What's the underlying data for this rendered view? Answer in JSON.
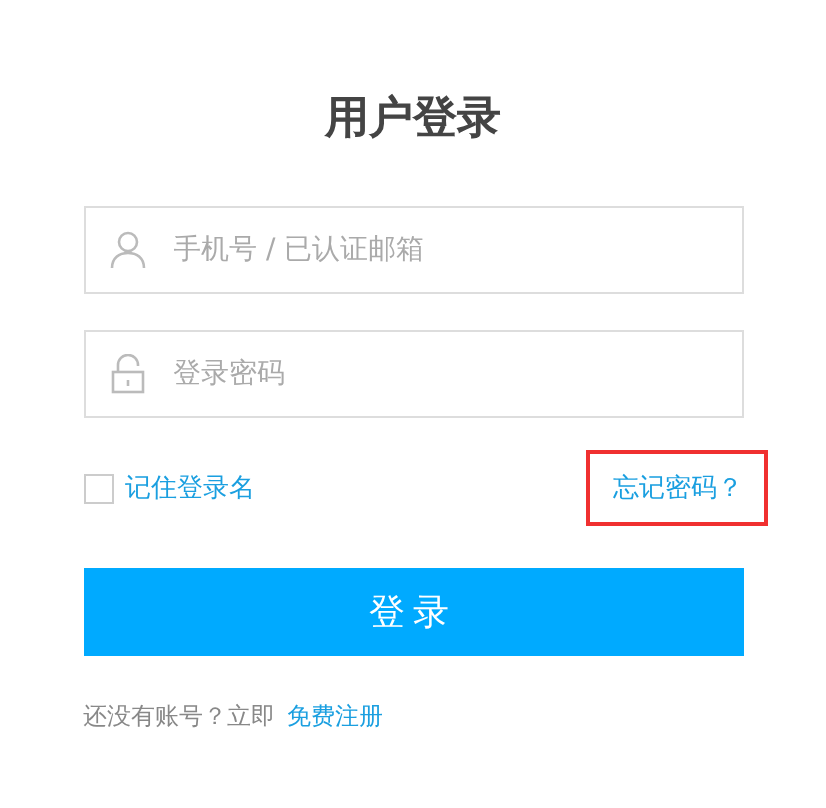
{
  "title": "用户登录",
  "fields": [
    {
      "kind": "user",
      "placeholder": "手机号 / 已认证邮箱"
    },
    {
      "kind": "password",
      "placeholder": "登录密码"
    }
  ],
  "remember": {
    "label": "记住登录名",
    "checked": false
  },
  "forgot": {
    "label": "忘记密码？",
    "highlighted": true
  },
  "submit": "登录",
  "footer": {
    "text": "还没有账号？立即",
    "link": "免费注册"
  }
}
